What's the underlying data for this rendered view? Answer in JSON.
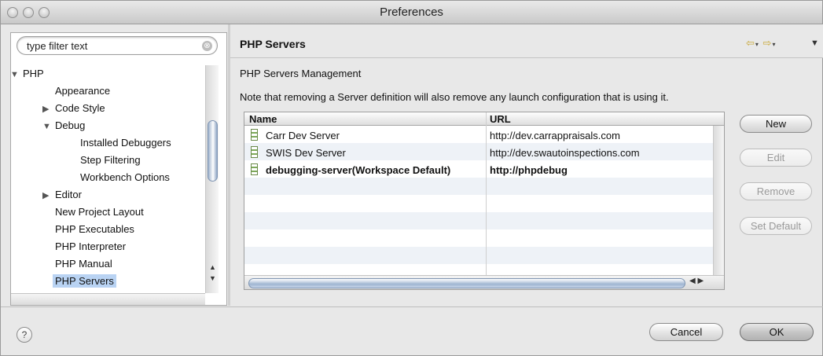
{
  "window": {
    "title": "Preferences"
  },
  "filter": {
    "placeholder": "type filter text",
    "clear_glyph": "⊗"
  },
  "tree": {
    "items": [
      {
        "label": "PHP",
        "expanded": true
      },
      {
        "label": "Appearance"
      },
      {
        "label": "Code Style",
        "expandable": true
      },
      {
        "label": "Debug",
        "expanded": true
      },
      {
        "label": "Installed Debuggers"
      },
      {
        "label": "Step Filtering"
      },
      {
        "label": "Workbench Options"
      },
      {
        "label": "Editor",
        "expandable": true
      },
      {
        "label": "New Project Layout"
      },
      {
        "label": "PHP Executables"
      },
      {
        "label": "PHP Interpreter"
      },
      {
        "label": "PHP Manual"
      },
      {
        "label": "PHP Servers",
        "selected": true
      }
    ],
    "arrow_up": "▲",
    "arrow_down": "▼",
    "expanded_glyph": "▼",
    "collapsed_glyph": "▶"
  },
  "page": {
    "title": "PHP Servers",
    "section_label": "PHP Servers Management",
    "note": "Note that removing a Server definition will also remove any launch configuration that is using it.",
    "nav_back": "⇦",
    "nav_forward": "⇨",
    "nav_menu": "▼"
  },
  "table": {
    "columns": [
      "Name",
      "URL"
    ],
    "rows": [
      {
        "name": "Carr Dev Server",
        "url": "http://dev.carrappraisals.com",
        "default": false
      },
      {
        "name": "SWIS Dev Server",
        "url": "http://dev.swautoinspections.com",
        "default": false
      },
      {
        "name": "debugging-server(Workspace Default)",
        "url": "http://phpdebug",
        "default": true
      }
    ],
    "scroll_arrows": "◀ ▶"
  },
  "buttons": {
    "new": "New",
    "edit": "Edit",
    "remove": "Remove",
    "set_default": "Set Default",
    "cancel": "Cancel",
    "ok": "OK"
  },
  "help": {
    "glyph": "?"
  },
  "colors": {
    "selection": "#b9d3f3",
    "server_icon": "#7da95a"
  }
}
